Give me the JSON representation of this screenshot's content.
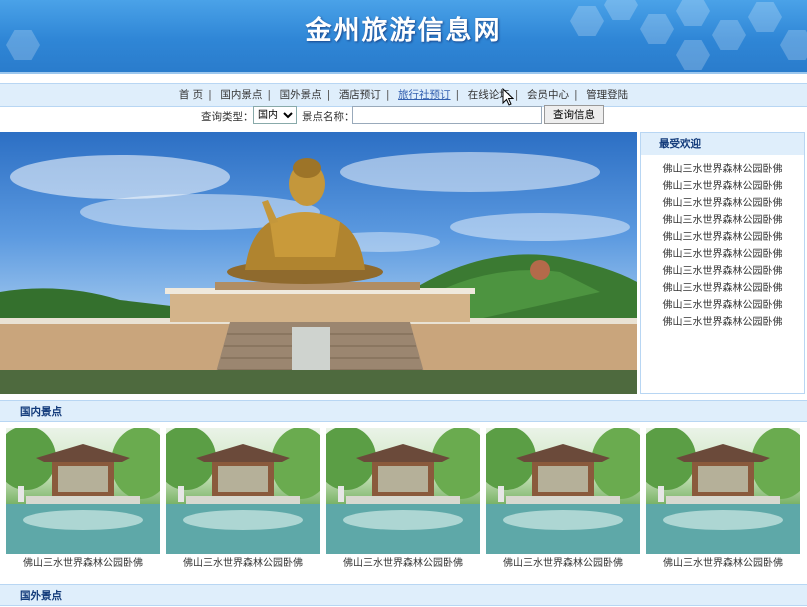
{
  "site": {
    "title": "金州旅游信息网"
  },
  "nav": {
    "items": [
      {
        "label": "首 页"
      },
      {
        "label": "国内景点"
      },
      {
        "label": "国外景点"
      },
      {
        "label": "酒店预订"
      },
      {
        "label": "旅行社预订"
      },
      {
        "label": "在线论坛"
      },
      {
        "label": "会员中心"
      },
      {
        "label": "管理登陆"
      }
    ],
    "separator": "|"
  },
  "search": {
    "type_label": "查询类型：",
    "type_value": "国内",
    "name_label": "景点名称：",
    "name_value": "",
    "button_label": "查询信息"
  },
  "popular": {
    "title": "最受欢迎",
    "items": [
      "佛山三水世界森林公园卧佛",
      "佛山三水世界森林公园卧佛",
      "佛山三水世界森林公园卧佛",
      "佛山三水世界森林公园卧佛",
      "佛山三水世界森林公园卧佛",
      "佛山三水世界森林公园卧佛",
      "佛山三水世界森林公园卧佛",
      "佛山三水世界森林公园卧佛",
      "佛山三水世界森林公园卧佛",
      "佛山三水世界森林公园卧佛"
    ]
  },
  "domestic": {
    "title": "国内景点",
    "items": [
      {
        "caption": "佛山三水世界森林公园卧佛"
      },
      {
        "caption": "佛山三水世界森林公园卧佛"
      },
      {
        "caption": "佛山三水世界森林公园卧佛"
      },
      {
        "caption": "佛山三水世界森林公园卧佛"
      },
      {
        "caption": "佛山三水世界森林公园卧佛"
      }
    ]
  },
  "foreign": {
    "title": "国外景点"
  },
  "colors": {
    "banner": "#2f86d6",
    "section_bg": "#dfeefb",
    "section_text": "#123a7a"
  }
}
